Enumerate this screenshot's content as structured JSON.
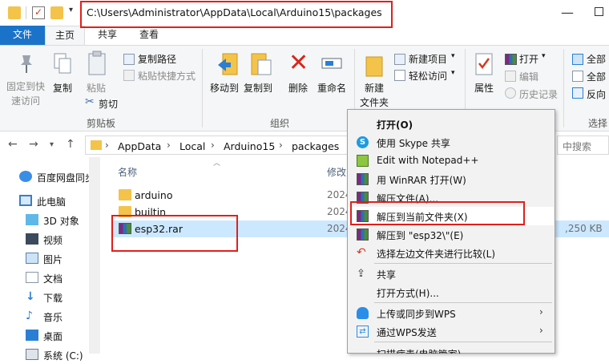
{
  "window": {
    "title_path": "C:\\Users\\Administrator\\AppData\\Local\\Arduino15\\packages"
  },
  "tabs": {
    "file": "文件",
    "home": "主页",
    "share": "共享",
    "view": "查看"
  },
  "ribbon": {
    "pin": [
      "固定到快",
      "速访问"
    ],
    "copy": "复制",
    "paste": "粘贴",
    "copy_path": "复制路径",
    "paste_shortcut": "粘贴快捷方式",
    "cut": "剪切",
    "group_clipboard": "剪贴板",
    "move_to": "移动到",
    "copy_to": "复制到",
    "delete": "删除",
    "rename": "重命名",
    "group_organize": "组织",
    "new_folder": [
      "新建",
      "文件夹"
    ],
    "new_item": "新建项目",
    "easy_access": "轻松访问",
    "properties": "属性",
    "open": "打开",
    "edit": "编辑",
    "history": "历史记录",
    "select_all_1": "全部",
    "select_all_2": "全部",
    "invert": "反向",
    "group_select": "选择"
  },
  "address": {
    "crumbs": [
      "AppData",
      "Local",
      "Arduino15",
      "packages"
    ],
    "search_placeholder": "中搜索"
  },
  "nav": {
    "items": [
      "百度网盘同步",
      "此电脑",
      "3D 对象",
      "视频",
      "图片",
      "文档",
      "下载",
      "音乐",
      "桌面",
      "系统 (C:)"
    ]
  },
  "files": {
    "col_name": "名称",
    "col_modified": "修改",
    "rows": [
      {
        "name": "arduino",
        "date": "2024"
      },
      {
        "name": "builtin",
        "date": "2024"
      },
      {
        "name": "esp32.rar",
        "date": "2024",
        "size": ",250 KB"
      }
    ]
  },
  "context_menu": {
    "items": [
      "打开(O)",
      "使用 Skype 共享",
      "Edit with Notepad++",
      "用 WinRAR 打开(W)",
      "解压文件(A)...",
      "解压到当前文件夹(X)",
      "解压到 \"esp32\\\"(E)",
      "选择左边文件夹进行比较(L)",
      "共享",
      "打开方式(H)...",
      "上传或同步到WPS",
      "通过WPS发送",
      "扫描病毒(电脑管家)"
    ]
  },
  "colors": {
    "accent": "#1a73c9",
    "selection": "#cce8ff",
    "annotation": "#e0201b"
  }
}
